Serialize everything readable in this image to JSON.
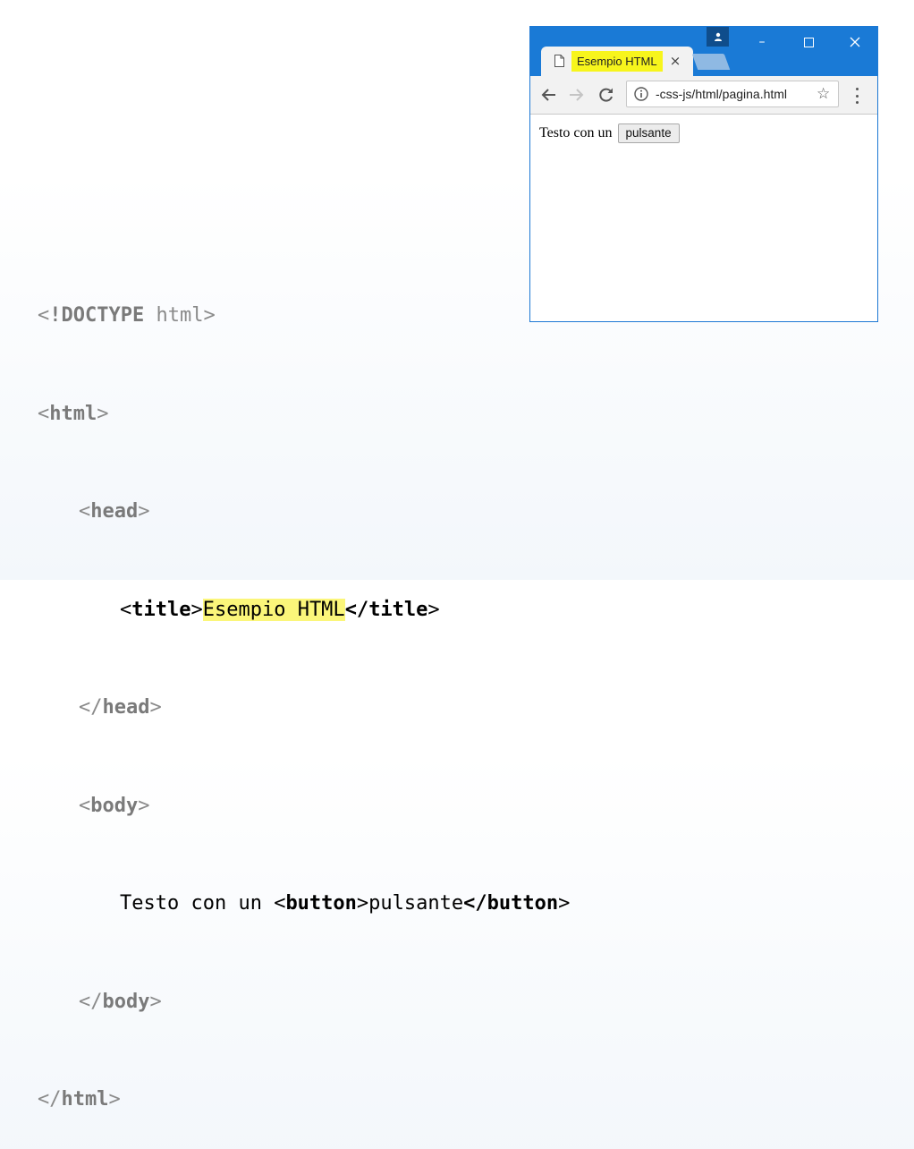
{
  "code": {
    "doctype_open": "<",
    "doctype_kw": "!DOCTYPE",
    "doctype_rest": " html>",
    "html_open": "<",
    "html_tag": "html",
    "html_close": ">",
    "head_open": "<",
    "head_tag": "head",
    "head_close": ">",
    "title_lt": "<",
    "title_tag": "title",
    "title_gt": ">",
    "title_text": "Esempio HTML",
    "title_end_lt": "</",
    "title_end_tag": "title",
    "title_end_gt": ">",
    "head_end_open": "</",
    "head_end_tag": "head",
    "head_end_close": ">",
    "body_open": "<",
    "body_tag": "body",
    "body_close": ">",
    "body_text": "Testo con un ",
    "button_lt": "<",
    "button_tag": "button",
    "button_gt": ">",
    "button_text": "pulsante",
    "button_end_lt": "</",
    "button_end_tag": "button",
    "button_end_gt": ">",
    "body_end_open": "</",
    "body_end_tag": "body",
    "body_end_close": ">",
    "html_end_open": "</",
    "html_end_tag": "html",
    "html_end_close": ">"
  },
  "browser": {
    "tab_title": "Esempio HTML",
    "tab_close": "×",
    "window_minimize": "–",
    "window_maximize": "☐",
    "window_close": "✕",
    "url": "-css-js/html/pagina.html",
    "star": "☆",
    "page_text": "Testo con un",
    "page_button": "pulsante"
  },
  "colors": {
    "highlight": "#fbf67a",
    "chrome_blue": "#1a7ad6",
    "tab_highlight": "#f7f51c"
  }
}
